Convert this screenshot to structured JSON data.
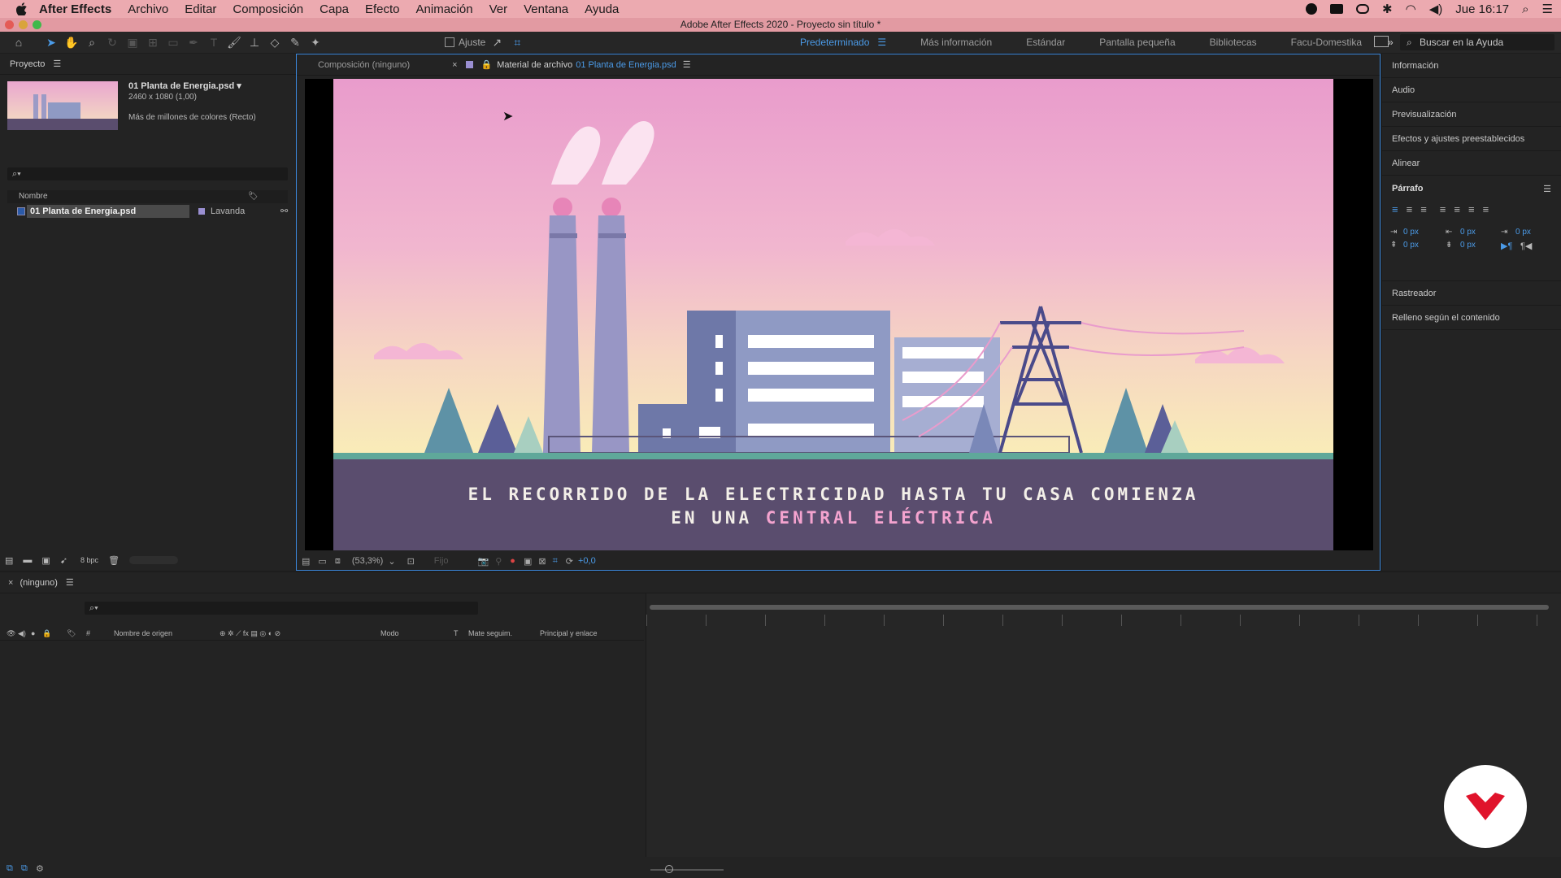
{
  "menubar": {
    "app_name": "After Effects",
    "items": [
      "Archivo",
      "Editar",
      "Composición",
      "Capa",
      "Efecto",
      "Animación",
      "Ver",
      "Ventana",
      "Ayuda"
    ],
    "clock": "Jue 16:17"
  },
  "window": {
    "title": "Adobe After Effects 2020 - Proyecto sin título *"
  },
  "toolbar": {
    "snap_label": "Ajuste",
    "workspaces": [
      "Predeterminado",
      "Más información",
      "Estándar",
      "Pantalla pequeña",
      "Bibliotecas",
      "Facu-Domestika"
    ],
    "active_workspace": "Predeterminado",
    "help_search_placeholder": "Buscar en la Ayuda"
  },
  "project_panel": {
    "title": "Proyecto",
    "item_name": "01 Planta de Energia.psd ▾",
    "item_dims": "2460 x 1080 (1,00)",
    "item_colors": "Más de millones de colores (Recto)",
    "col_name": "Nombre",
    "rows": [
      {
        "name": "01 Planta de Energia.psd",
        "label": "Lavanda"
      }
    ],
    "bpc": "8 bpc"
  },
  "comp_panel": {
    "tab_comp": "Composición (ninguno)",
    "tab_footage_prefix": "Material de archivo",
    "tab_footage_name": "01 Planta de Energia.psd",
    "caption_line1": "EL RECORRIDO DE LA ELECTRICIDAD HASTA TU CASA COMIENZA",
    "caption_line2_prefix": "EN UNA",
    "caption_line2_highlight": "CENTRAL ELÉCTRICA",
    "zoom": "(53,3%)",
    "resolution": "Fijo",
    "exposure": "+0,0"
  },
  "right_panel": {
    "items": [
      "Información",
      "Audio",
      "Previsualización",
      "Efectos y ajustes preestablecidos",
      "Alinear"
    ],
    "paragraph_title": "Párrafo",
    "indent_values": [
      "0 px",
      "0 px",
      "0 px",
      "0 px",
      "0 px"
    ],
    "items_after": [
      "Rastreador",
      "Relleno según el contenido"
    ]
  },
  "timeline": {
    "tab": "(ninguno)",
    "col_source": "Nombre de origen",
    "col_mode": "Modo",
    "col_t": "T",
    "col_matte": "Mate seguim.",
    "col_parent": "Principal y enlace"
  },
  "colors": {
    "accent": "#4b9be8",
    "menubar": "#ecaab0",
    "logo_red": "#e0132b",
    "label_lavender": "#9a8fd1"
  }
}
